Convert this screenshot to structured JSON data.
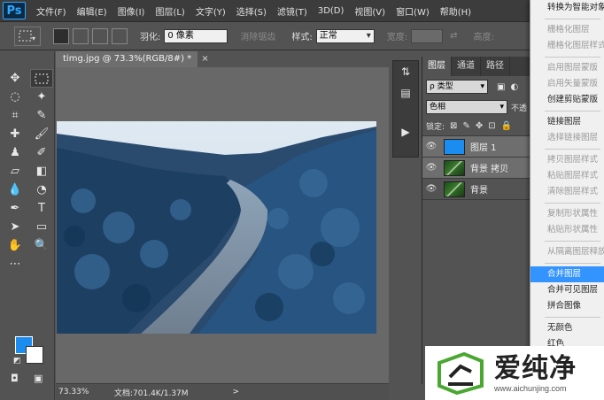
{
  "app": {
    "logo": "Ps"
  },
  "menu": [
    "文件(F)",
    "编辑(E)",
    "图像(I)",
    "图层(L)",
    "文字(Y)",
    "选择(S)",
    "滤镜(T)",
    "3D(D)",
    "视图(V)",
    "窗口(W)",
    "帮助(H)"
  ],
  "options": {
    "feather_label": "羽化:",
    "feather_value": "0 像素",
    "antialias_label": "消除锯齿",
    "style_label": "样式:",
    "style_value": "正常",
    "width_label": "宽度:",
    "height_label": "高度:"
  },
  "document": {
    "tab_title": "timg.jpg @ 73.3%(RGB/8#) *",
    "close": "×",
    "zoom": "73.33%",
    "info": "文档:701.4K/1.37M",
    "status_arrow": ">"
  },
  "colors": {
    "foreground": "#1b8cf0",
    "background": "#ffffff",
    "highlight": "#3393ff"
  },
  "layers_panel": {
    "tabs": [
      "图层",
      "通道",
      "路径"
    ],
    "filter": "ρ 类型",
    "blend_mode": "色相",
    "opacity_label": "不透",
    "lock_label": "锁定:",
    "layers": [
      {
        "name": "图层 1",
        "thumb": "blue",
        "selected": true
      },
      {
        "name": "背景 拷贝",
        "thumb": "pic",
        "selected": true
      },
      {
        "name": "背景",
        "thumb": "pic",
        "selected": false
      }
    ]
  },
  "context_menu": {
    "items": [
      {
        "label": "转换为智能对象",
        "state": "normal"
      },
      {
        "sep": true
      },
      {
        "label": "栅格化图层",
        "state": "disabled"
      },
      {
        "label": "栅格化图层样式",
        "state": "disabled"
      },
      {
        "sep": true
      },
      {
        "label": "启用图层蒙版",
        "state": "disabled"
      },
      {
        "label": "启用矢量蒙版",
        "state": "disabled"
      },
      {
        "label": "创建剪贴蒙版",
        "state": "normal"
      },
      {
        "sep": true
      },
      {
        "label": "链接图层",
        "state": "normal"
      },
      {
        "label": "选择链接图层",
        "state": "disabled"
      },
      {
        "sep": true
      },
      {
        "label": "拷贝图层样式",
        "state": "disabled"
      },
      {
        "label": "粘贴图层样式",
        "state": "disabled"
      },
      {
        "label": "清除图层样式",
        "state": "disabled"
      },
      {
        "sep": true
      },
      {
        "label": "复制形状属性",
        "state": "disabled"
      },
      {
        "label": "粘贴形状属性",
        "state": "disabled"
      },
      {
        "sep": true
      },
      {
        "label": "从隔离图层释放",
        "state": "disabled"
      },
      {
        "sep": true
      },
      {
        "label": "合并图层",
        "state": "highlight"
      },
      {
        "label": "合并可见图层",
        "state": "normal"
      },
      {
        "label": "拼合图像",
        "state": "normal"
      },
      {
        "sep": true
      },
      {
        "label": "无颜色",
        "state": "normal"
      },
      {
        "label": "红色",
        "state": "normal"
      }
    ]
  },
  "watermark": {
    "brand": "爱纯净",
    "url": "www.aichunjing.com"
  }
}
